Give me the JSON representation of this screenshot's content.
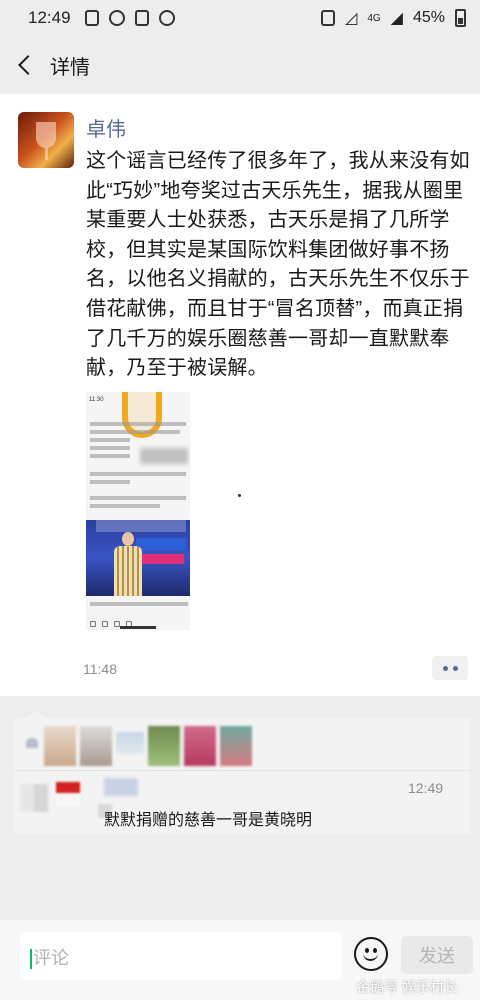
{
  "status_bar": {
    "time": "12:49",
    "network": "4G",
    "battery": "45%",
    "battery_level": 0.45
  },
  "nav": {
    "title": "详情"
  },
  "post": {
    "author": "卓伟",
    "text": "这个谣言已经传了很多年了，我从来没有如此“巧妙”地夸奖过古天乐先生，据我从圈里某重要人士处获悉，古天乐是捐了几所学校，但其实是某国际饮料集团做好事不扬名，以他名义捐献的，古天乐先生不仅乐于借花献佛，而且甘于“冒名顶替”，而真正捐了几千万的娱乐圈慈善一哥却一直默默奉献，乃至于被误解。",
    "image": {
      "time": "11:30"
    },
    "time": "11:48"
  },
  "comment": {
    "time": "12:49",
    "text": "默默捐赠的慈善一哥是黄晓明"
  },
  "input": {
    "placeholder": "评论",
    "send_label": "发送"
  },
  "watermark": "企鹅号 娱乐村长",
  "colors": {
    "link": "#576b95",
    "background": "#ededed",
    "card": "#ffffff",
    "accent": "#07c160"
  }
}
